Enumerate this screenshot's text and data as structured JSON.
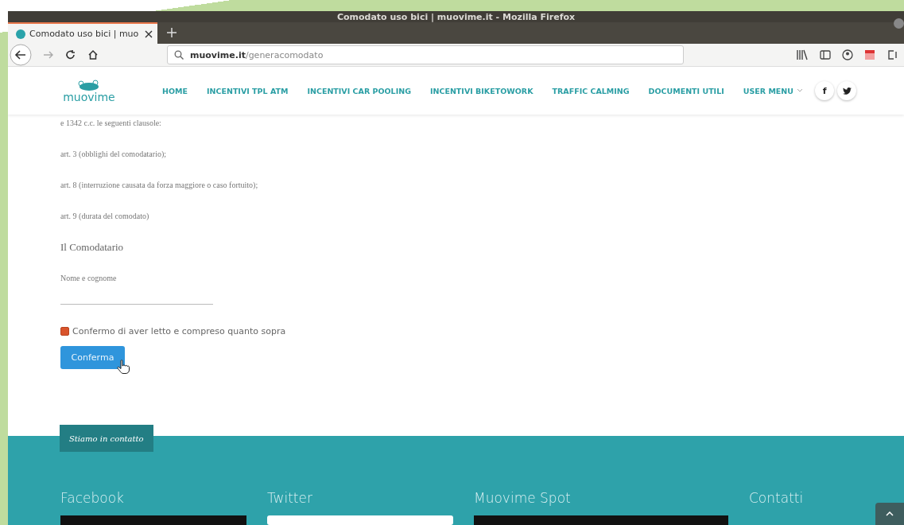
{
  "window": {
    "title": "Comodato uso bici | muovime.it - Mozilla Firefox"
  },
  "tabs": [
    {
      "label": "Comodato uso bici | muo",
      "selected": true
    }
  ],
  "address_bar": {
    "host": "muovime.it",
    "path": "/generacomodato"
  },
  "site": {
    "logo": "muovime",
    "nav": [
      {
        "label": "HOME",
        "dropdown": false
      },
      {
        "label": "INCENTIVI TPL ATM",
        "dropdown": false
      },
      {
        "label": "INCENTIVI CAR POOLING",
        "dropdown": false
      },
      {
        "label": "INCENTIVI BIKETOWORK",
        "dropdown": false
      },
      {
        "label": "TRAFFIC CALMING",
        "dropdown": false
      },
      {
        "label": "DOCUMENTI UTILI",
        "dropdown": false
      },
      {
        "label": "USER MENU",
        "dropdown": true
      }
    ],
    "social": [
      {
        "kind": "facebook",
        "label": "f"
      },
      {
        "kind": "twitter"
      }
    ]
  },
  "content": {
    "paragraphs": [
      {
        "text": "e 1342 c.c. le seguenti clausole:",
        "kind": "small"
      },
      {
        "text": "art. 3 (obblighi del comodatario);",
        "kind": "small"
      },
      {
        "text": "art. 8 (interruzione causata da forza maggiore o caso fortuito);",
        "kind": "small"
      },
      {
        "text": "art. 9 (durata del comodato)",
        "kind": "small"
      },
      {
        "text": "Il Comodatario",
        "kind": "large"
      },
      {
        "text": "Nome e cognome",
        "kind": "small"
      }
    ],
    "confirm_checkbox": {
      "label": "Confermo di aver letto e compreso quanto sopra",
      "checked": true
    },
    "button": "Conferma"
  },
  "footer": {
    "badge": "Stiamo in contatto",
    "columns": [
      {
        "title": "Facebook",
        "kind": "dark"
      },
      {
        "title": "Twitter",
        "kind": "light"
      },
      {
        "title": "Muovime Spot",
        "kind": "dark"
      },
      {
        "title": "Contatti",
        "kind": "none"
      }
    ]
  }
}
